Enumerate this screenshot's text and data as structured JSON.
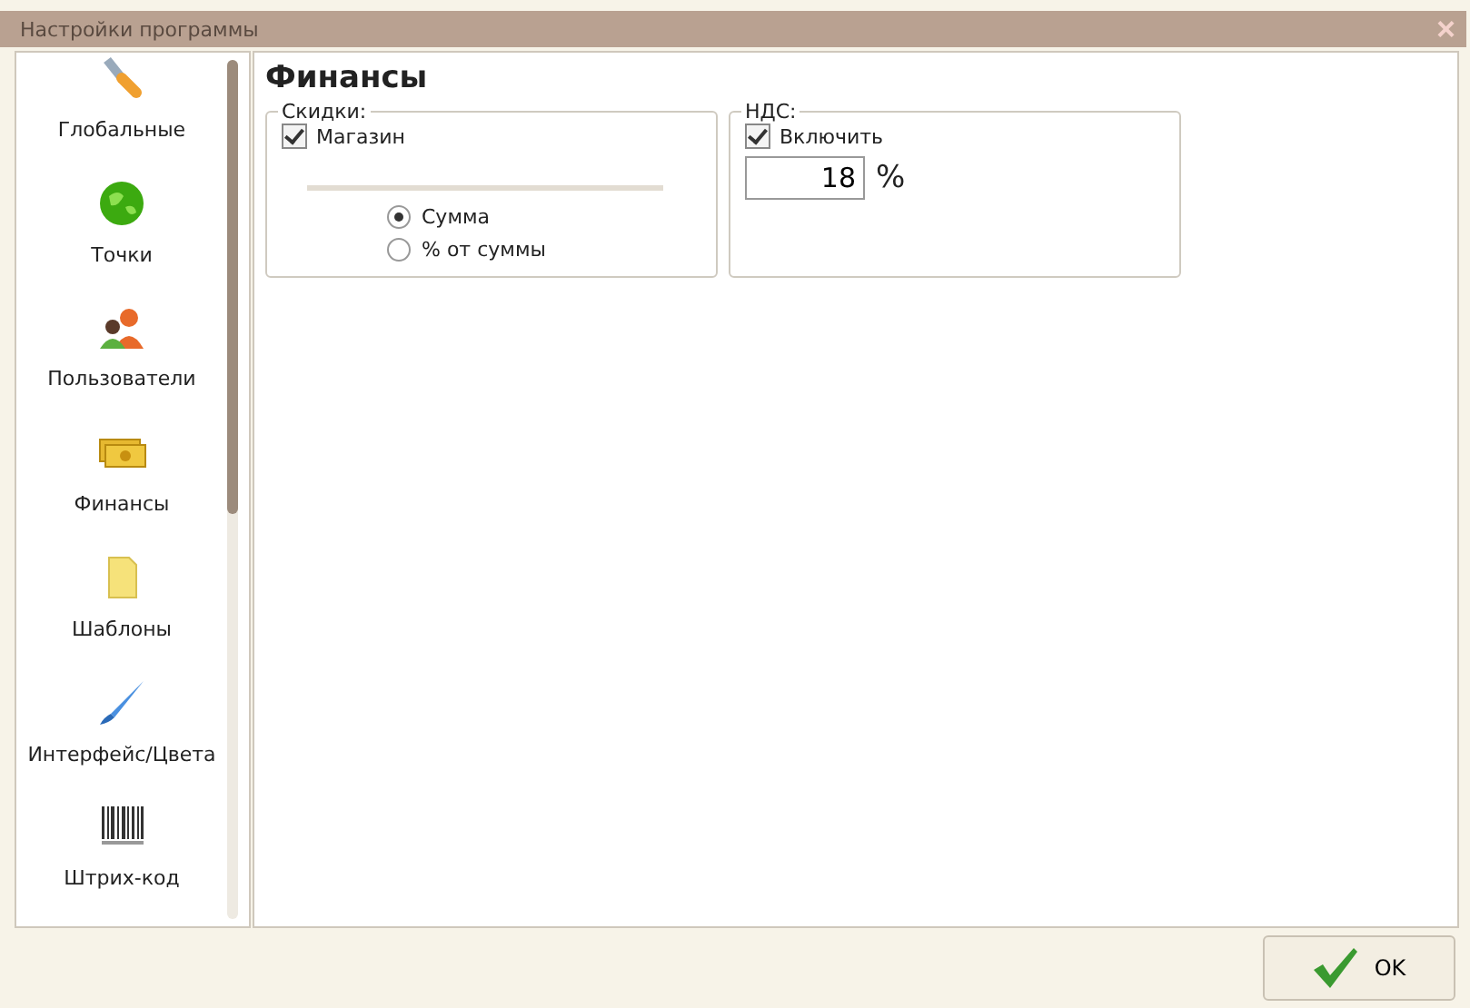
{
  "window": {
    "title": "Настройки программы",
    "close": "×"
  },
  "sidebar": {
    "items": [
      {
        "label": "Глобальные"
      },
      {
        "label": "Точки"
      },
      {
        "label": "Пользователи"
      },
      {
        "label": "Финансы"
      },
      {
        "label": "Шаблоны"
      },
      {
        "label": "Интерфейс/Цвета"
      },
      {
        "label": "Штрих-код"
      }
    ]
  },
  "page_title": "Финансы",
  "discounts": {
    "legend": "Скидки:",
    "checkbox": {
      "label": "Магазин",
      "checked": true
    },
    "options": [
      {
        "label": "Сумма",
        "selected": true
      },
      {
        "label": "% от суммы",
        "selected": false
      }
    ]
  },
  "vat": {
    "legend": "НДС:",
    "checkbox": {
      "label": "Включить",
      "checked": true
    },
    "value": "18",
    "unit": "%"
  },
  "buttons": [
    {
      "label": "OK"
    }
  ]
}
